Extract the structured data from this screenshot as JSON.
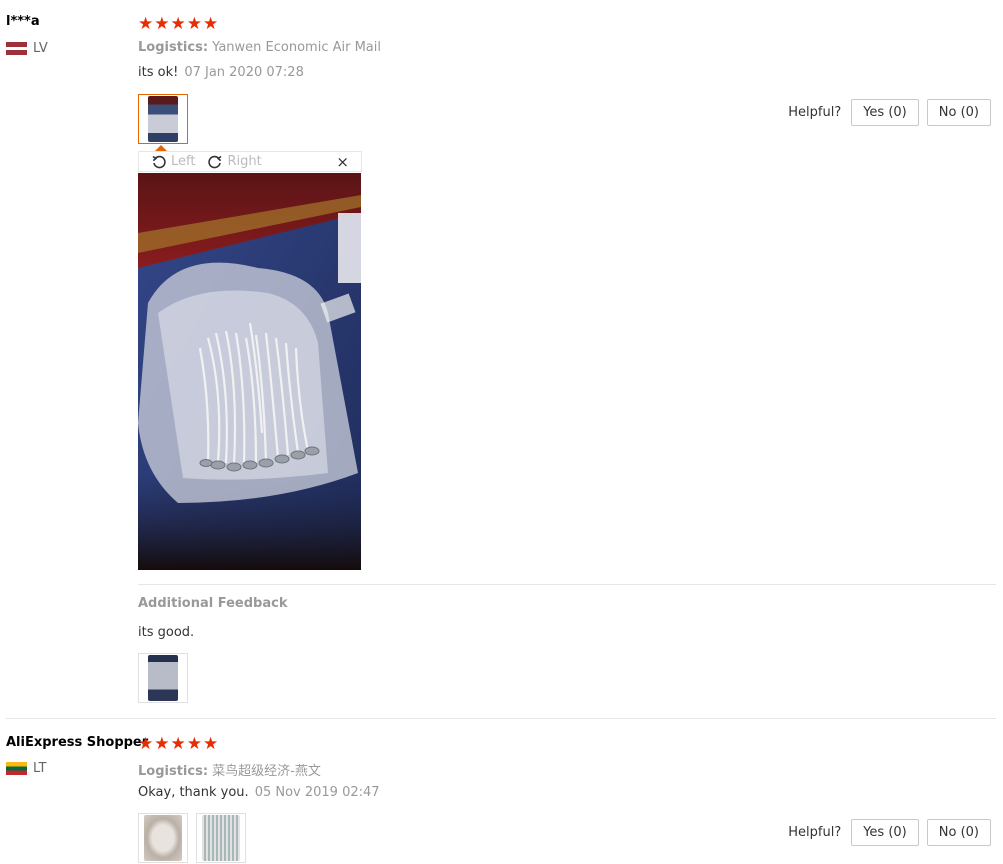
{
  "reviews": [
    {
      "user": "l***a",
      "country": "LV",
      "stars": [
        "★",
        "★",
        "★",
        "★",
        "★"
      ],
      "logistics_label": "Logistics:",
      "logistics_value": "Yanwen Economic Air Mail",
      "comment": "its ok!",
      "date": "07 Jan 2020 07:28",
      "helpful_label": "Helpful?",
      "yes_label": "Yes (0)",
      "no_label": "No (0)",
      "viewer": {
        "left_label": "Left",
        "right_label": "Right",
        "close": "×"
      },
      "additional": {
        "title": "Additional Feedback",
        "text": "its good."
      }
    },
    {
      "user": "AliExpress Shopper",
      "country": "LT",
      "stars": [
        "★",
        "★",
        "★",
        "★",
        "★"
      ],
      "logistics_label": "Logistics:",
      "logistics_value": "菜鸟超级经济-燕文",
      "comment": "Okay, thank you.",
      "date": "05 Nov 2019 02:47",
      "helpful_label": "Helpful?",
      "yes_label": "Yes (0)",
      "no_label": "No (0)"
    }
  ],
  "colors": {
    "star": "#e62e04",
    "active_border": "#e56600",
    "muted": "#999999"
  }
}
